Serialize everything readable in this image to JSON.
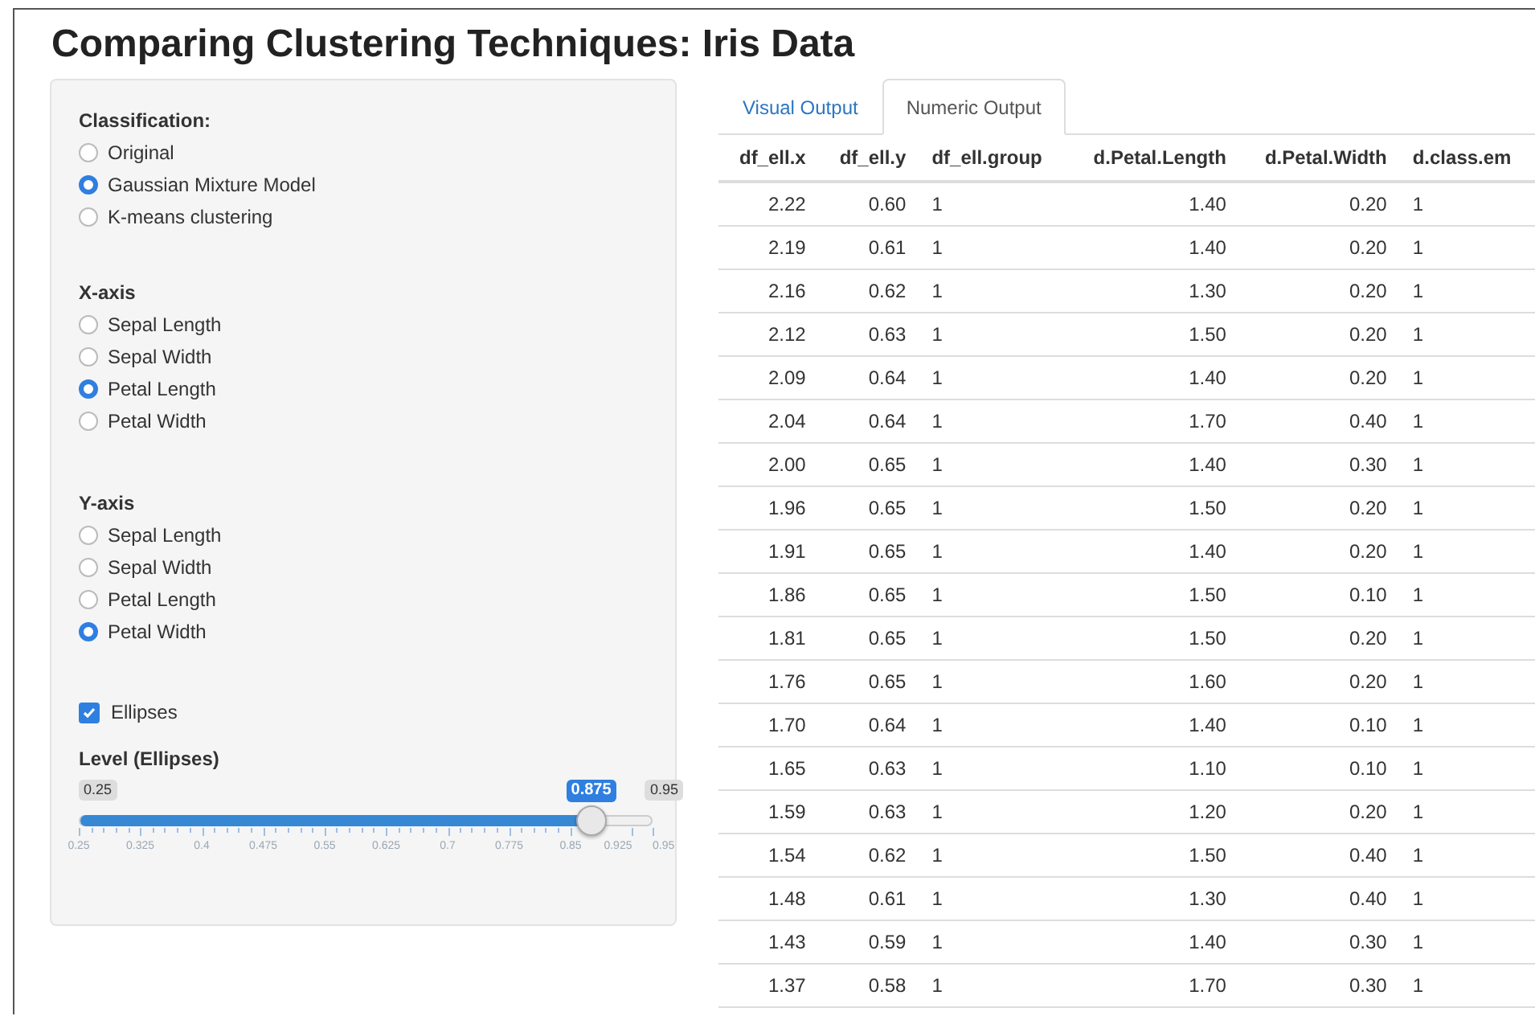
{
  "title": "Comparing Clustering Techniques: Iris Data",
  "sidebar": {
    "radio_groups": [
      {
        "label": "Classification:",
        "options": [
          {
            "label": "Original",
            "selected": false
          },
          {
            "label": "Gaussian Mixture Model",
            "selected": true
          },
          {
            "label": "K-means clustering",
            "selected": false
          }
        ]
      },
      {
        "label": "X-axis",
        "options": [
          {
            "label": "Sepal Length",
            "selected": false
          },
          {
            "label": "Sepal Width",
            "selected": false
          },
          {
            "label": "Petal Length",
            "selected": true
          },
          {
            "label": "Petal Width",
            "selected": false
          }
        ]
      },
      {
        "label": "Y-axis",
        "options": [
          {
            "label": "Sepal Length",
            "selected": false
          },
          {
            "label": "Sepal Width",
            "selected": false
          },
          {
            "label": "Petal Length",
            "selected": false
          },
          {
            "label": "Petal Width",
            "selected": true
          }
        ]
      }
    ],
    "checkbox": {
      "label": "Ellipses",
      "checked": true
    },
    "slider": {
      "label": "Level (Ellipses)",
      "min_label": "0.25",
      "max_label": "0.95",
      "value_label": "0.875",
      "level": 0.893,
      "ticks": [
        "0.25",
        "0.325",
        "0.4",
        "0.475",
        "0.55",
        "0.625",
        "0.7",
        "0.775",
        "0.85",
        "0.925",
        "0.95"
      ]
    }
  },
  "tabs": [
    {
      "label": "Visual Output",
      "selected": false
    },
    {
      "label": "Numeric Output",
      "selected": true
    }
  ],
  "table": {
    "columns": [
      {
        "label": "df_ell.x",
        "kind": "number"
      },
      {
        "label": "df_ell.y",
        "kind": "number"
      },
      {
        "label": "df_ell.group",
        "kind": "factor"
      },
      {
        "label": "d.Petal.Length",
        "kind": "number"
      },
      {
        "label": "d.Petal.Width",
        "kind": "number"
      },
      {
        "label": "d.class.em",
        "kind": "factor"
      }
    ],
    "rows": [
      [
        "2.22",
        "0.60",
        "1",
        "1.40",
        "0.20",
        "1"
      ],
      [
        "2.19",
        "0.61",
        "1",
        "1.40",
        "0.20",
        "1"
      ],
      [
        "2.16",
        "0.62",
        "1",
        "1.30",
        "0.20",
        "1"
      ],
      [
        "2.12",
        "0.63",
        "1",
        "1.50",
        "0.20",
        "1"
      ],
      [
        "2.09",
        "0.64",
        "1",
        "1.40",
        "0.20",
        "1"
      ],
      [
        "2.04",
        "0.64",
        "1",
        "1.70",
        "0.40",
        "1"
      ],
      [
        "2.00",
        "0.65",
        "1",
        "1.40",
        "0.30",
        "1"
      ],
      [
        "1.96",
        "0.65",
        "1",
        "1.50",
        "0.20",
        "1"
      ],
      [
        "1.91",
        "0.65",
        "1",
        "1.40",
        "0.20",
        "1"
      ],
      [
        "1.86",
        "0.65",
        "1",
        "1.50",
        "0.10",
        "1"
      ],
      [
        "1.81",
        "0.65",
        "1",
        "1.50",
        "0.20",
        "1"
      ],
      [
        "1.76",
        "0.65",
        "1",
        "1.60",
        "0.20",
        "1"
      ],
      [
        "1.70",
        "0.64",
        "1",
        "1.40",
        "0.10",
        "1"
      ],
      [
        "1.65",
        "0.63",
        "1",
        "1.10",
        "0.10",
        "1"
      ],
      [
        "1.59",
        "0.63",
        "1",
        "1.20",
        "0.20",
        "1"
      ],
      [
        "1.54",
        "0.62",
        "1",
        "1.50",
        "0.40",
        "1"
      ],
      [
        "1.48",
        "0.61",
        "1",
        "1.30",
        "0.40",
        "1"
      ],
      [
        "1.43",
        "0.59",
        "1",
        "1.40",
        "0.30",
        "1"
      ],
      [
        "1.37",
        "0.58",
        "1",
        "1.70",
        "0.30",
        "1"
      ]
    ]
  }
}
